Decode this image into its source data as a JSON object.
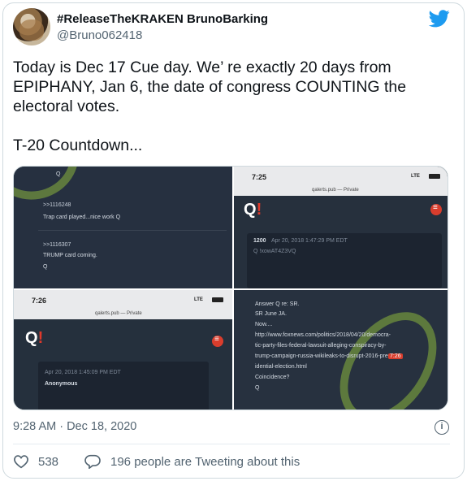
{
  "tweet": {
    "display_name": "#ReleaseTheKRAKEN BrunoBarking",
    "handle": "@Bruno062418",
    "text_lines": [
      "Today is Dec 17 Cue day. We’  re exactly 20 days from",
      "EPIPHANY, Jan 6, the date of congress COUNTING the",
      "electoral votes.",
      "T-20 Countdown..."
    ],
    "timestamp": "9:28 AM · Dec 18, 2020",
    "likes": "538",
    "tweeting_about": "196 people are Tweeting about this"
  },
  "media": {
    "pane1": {
      "line1": "Q",
      "ref1": ">>1116248",
      "text1": "Trap card played...nice work Q",
      "ref2": ">>1116307",
      "text2": "TRUMP card coming.",
      "sign": "Q"
    },
    "pane2": {
      "time": "7:25",
      "signal": "LTE",
      "url": "qalerts.pub — Private",
      "post_num": "1200",
      "post_date": "Apr 20, 2018 1:47:29 PM EDT",
      "trip": "Q  !xowAT4Z3VQ"
    },
    "pane3": {
      "time": "7:26",
      "signal": "LTE",
      "url": "qalerts.pub — Private",
      "post_date": "Apr 20, 2018 1:45:09 PM EDT",
      "author": "Anonymous"
    },
    "pane4": {
      "lines": [
        "Answer Q re: SR.",
        "SR June JA.",
        "Now....",
        "http://www.foxnews.com/politics/2018/04/20/democra-",
        "tic-party-files-federal-lawsuit-alleging-conspiracy-by-",
        "trump-campaign-russia-wikileaks-to-disrupt-2016-pres-",
        "idential-election.html",
        "Coincidence?",
        "Q"
      ],
      "highlight": "7:26"
    },
    "q_logo_letter": "Q",
    "q_logo_mark": "!"
  },
  "icons": {
    "brand": "twitter-bird-icon",
    "like": "heart-icon",
    "reply": "speech-bubble-icon",
    "info": "info-icon"
  },
  "colors": {
    "twitter_blue": "#1d9bf0",
    "text_primary": "#0f1419",
    "text_secondary": "#536471",
    "q_red": "#e0392b"
  }
}
